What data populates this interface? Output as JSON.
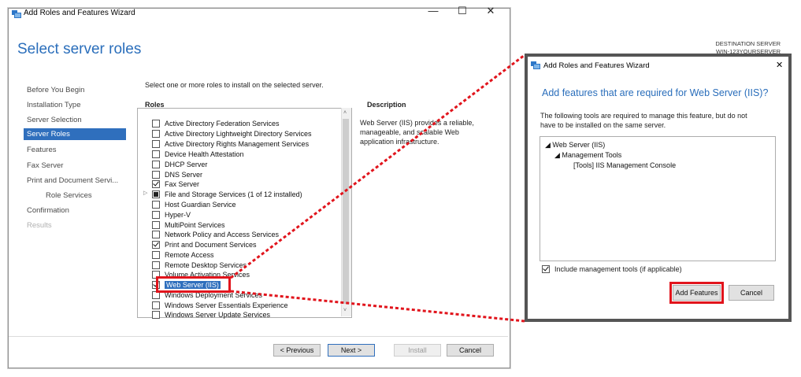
{
  "main_window": {
    "title": "Add Roles and Features Wizard",
    "controls": {
      "minimize": "—",
      "maximize": "☐",
      "close": "✕"
    },
    "page_title": "Select server roles",
    "destination_label": "DESTINATION SERVER",
    "destination_server": "WIN-123YOURSERVER",
    "nav": [
      {
        "label": "Before You Begin",
        "state": "normal"
      },
      {
        "label": "Installation Type",
        "state": "normal"
      },
      {
        "label": "Server Selection",
        "state": "normal"
      },
      {
        "label": "Server Roles",
        "state": "selected"
      },
      {
        "label": "Features",
        "state": "normal"
      },
      {
        "label": "Fax Server",
        "state": "normal"
      },
      {
        "label": "Print and Document Servi...",
        "state": "normal"
      },
      {
        "label": "Role Services",
        "state": "normal"
      },
      {
        "label": "Confirmation",
        "state": "normal"
      },
      {
        "label": "Results",
        "state": "disabled"
      }
    ],
    "instruction": "Select one or more roles to install on the selected server.",
    "roles_header": "Roles",
    "description_header": "Description",
    "description_text": "Web Server (IIS) provides a reliable, manageable, and scalable Web application infrastructure.",
    "roles": [
      {
        "label": "Active Directory Federation Services",
        "state": "unchecked"
      },
      {
        "label": "Active Directory Lightweight Directory Services",
        "state": "unchecked"
      },
      {
        "label": "Active Directory Rights Management Services",
        "state": "unchecked"
      },
      {
        "label": "Device Health Attestation",
        "state": "unchecked"
      },
      {
        "label": "DHCP Server",
        "state": "unchecked"
      },
      {
        "label": "DNS Server",
        "state": "unchecked"
      },
      {
        "label": "Fax Server",
        "state": "checked"
      },
      {
        "label": "File and Storage Services (1 of 12 installed)",
        "state": "partial"
      },
      {
        "label": "Host Guardian Service",
        "state": "unchecked"
      },
      {
        "label": "Hyper-V",
        "state": "unchecked"
      },
      {
        "label": "MultiPoint Services",
        "state": "unchecked"
      },
      {
        "label": "Network Policy and Access Services",
        "state": "unchecked"
      },
      {
        "label": "Print and Document Services",
        "state": "checked"
      },
      {
        "label": "Remote Access",
        "state": "unchecked"
      },
      {
        "label": "Remote Desktop Services",
        "state": "unchecked"
      },
      {
        "label": "Volume Activation Services",
        "state": "unchecked"
      },
      {
        "label": "Web Server (IIS)",
        "state": "checked"
      },
      {
        "label": "Windows Deployment Services",
        "state": "unchecked"
      },
      {
        "label": "Windows Server Essentials Experience",
        "state": "unchecked"
      },
      {
        "label": "Windows Server Update Services",
        "state": "unchecked"
      }
    ],
    "scroll_up": "˄",
    "scroll_down": "˅",
    "expander": "▷",
    "buttons": {
      "previous": "< Previous",
      "next": "Next >",
      "install": "Install",
      "cancel": "Cancel"
    }
  },
  "dialog": {
    "title": "Add Roles and Features Wizard",
    "close": "✕",
    "heading": "Add features that are required for Web Server (IIS)?",
    "body_line1": "The following tools are required to manage this feature, but do not",
    "body_line2": "have to be installed on the same server.",
    "tree": [
      {
        "label": "◢ Web Server (IIS)",
        "level": 0
      },
      {
        "label": "◢ Management Tools",
        "level": 1
      },
      {
        "label": "[Tools] IIS Management Console",
        "level": 2
      }
    ],
    "include_tools_label": "Include management tools (if applicable)",
    "buttons": {
      "add_features": "Add Features",
      "cancel": "Cancel"
    }
  },
  "annotation_color": "#e1141c"
}
